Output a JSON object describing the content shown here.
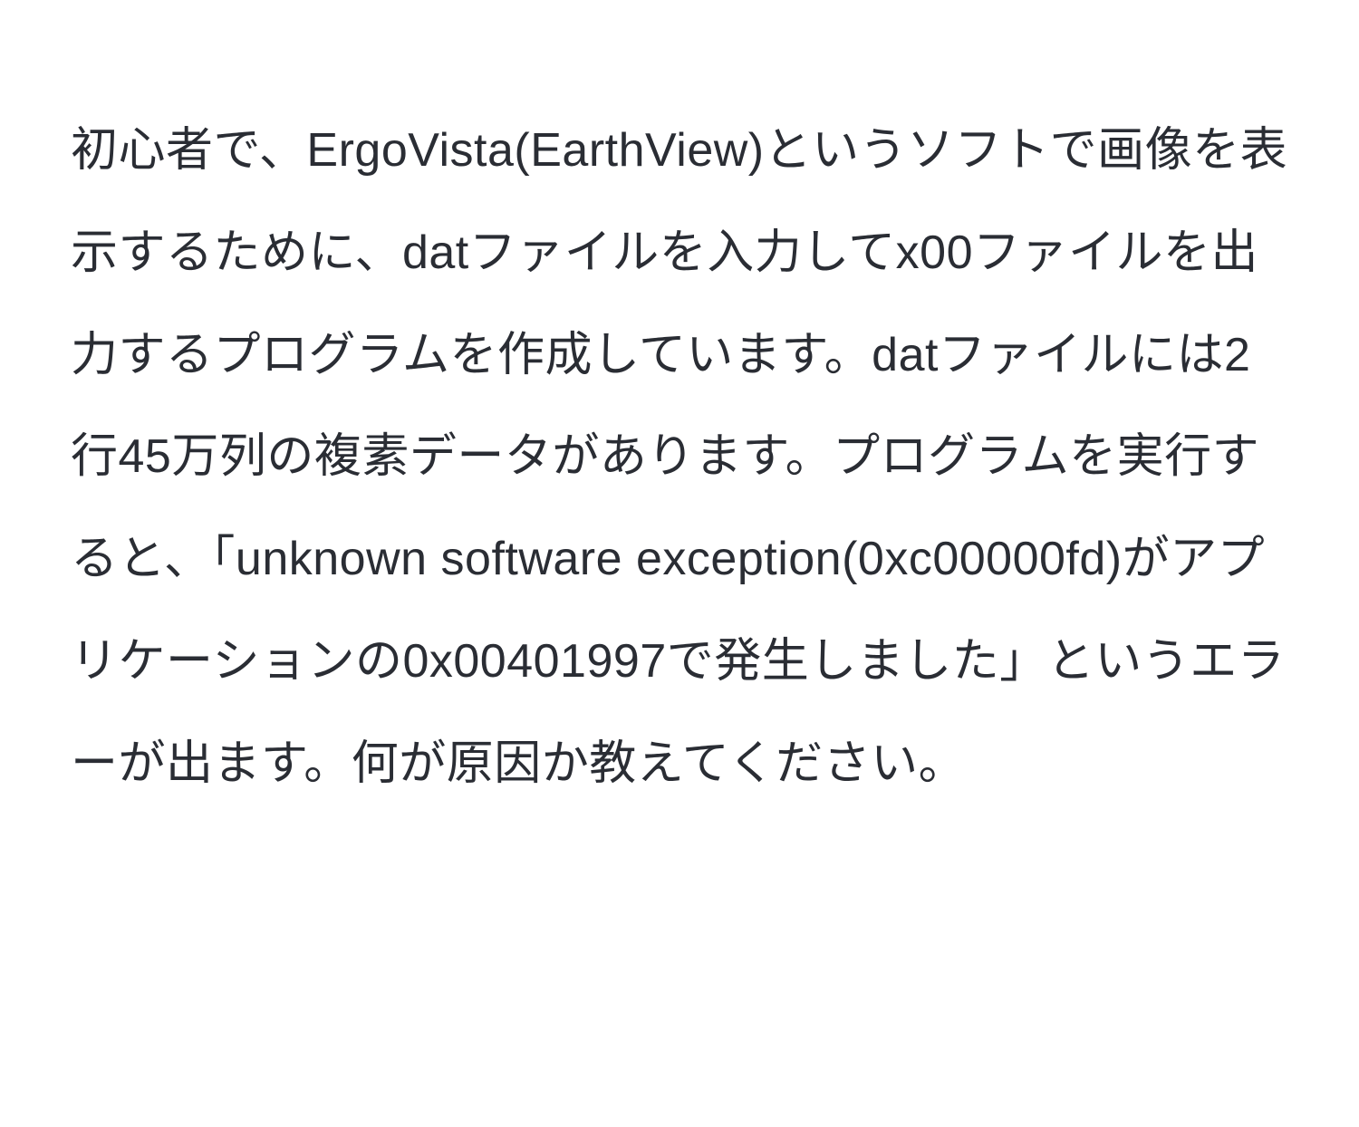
{
  "paragraph": "初心者で、ErgoVista(EarthView)というソフトで画像を表示するために、datファイルを入力してx00ファイルを出力するプログラムを作成しています。datファイルには2行45万列の複素データがあります。プログラムを実行すると、「unknown software exception(0xc00000fd)がアプリケーションの0x00401997で発生しました」というエラーが出ます。何が原因か教えてください。"
}
